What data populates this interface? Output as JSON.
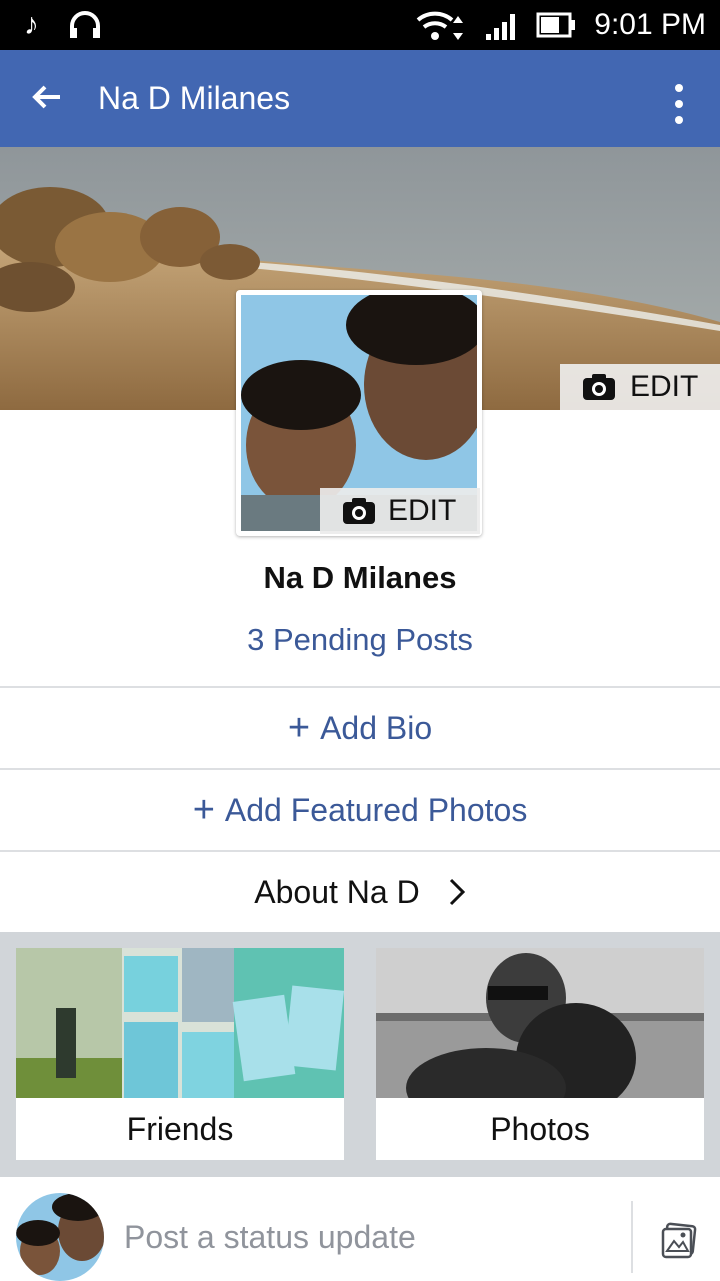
{
  "status_bar": {
    "time": "9:01 PM"
  },
  "app_bar": {
    "title": "Na D Milanes"
  },
  "cover": {
    "edit_label": "EDIT"
  },
  "profile": {
    "edit_label": "EDIT",
    "name": "Na D Milanes",
    "pending_posts": "3 Pending Posts"
  },
  "actions": {
    "add_bio": "Add Bio",
    "add_featured_photos": "Add Featured Photos",
    "about": "About Na D"
  },
  "cards": {
    "friends": "Friends",
    "photos": "Photos"
  },
  "composer": {
    "placeholder": "Post a status update"
  },
  "colors": {
    "brand": "#4267b2",
    "link": "#3b5998",
    "divider": "#dddfe2"
  }
}
